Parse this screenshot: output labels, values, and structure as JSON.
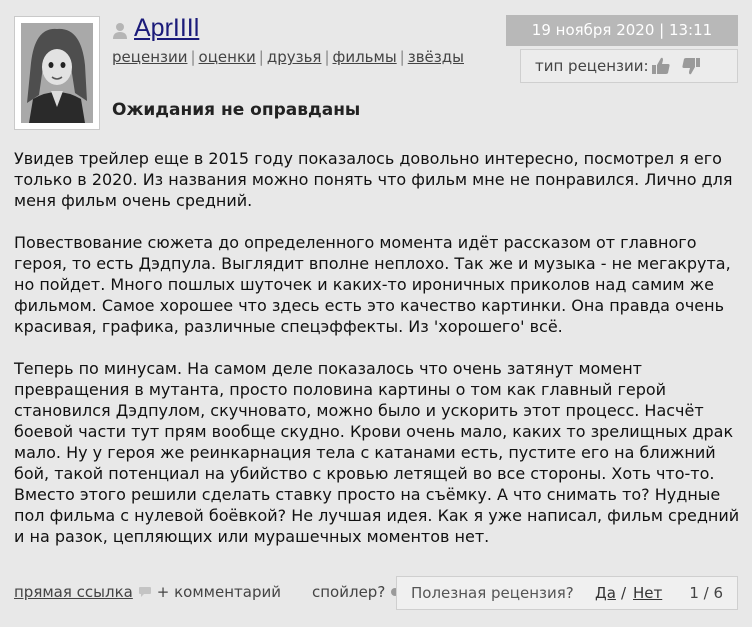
{
  "user": {
    "name": "AprIIIl",
    "tabs": [
      "рецензии",
      "оценки",
      "друзья",
      "фильмы",
      "звёзды"
    ]
  },
  "meta": {
    "date": "19 ноября 2020 | 13:11",
    "type_label": "тип рецензии:"
  },
  "review": {
    "title": "Ожидания не оправданы",
    "paragraphs": [
      "Увидев трейлер еще в 2015 году показалось довольно интересно, посмотрел я его только в 2020. Из названия можно понять что фильм мне не понравился. Лично для меня фильм очень средний.",
      "Повествование сюжета до определенного момента идёт рассказом от главного героя, то есть Дэдпула. Выглядит вполне неплохо. Так же и музыка - не мегакрута, но пойдет. Много пошлых шуточек и каких-то ироничных приколов над самим же фильмом. Самое хорошее что здесь есть это качество картинки. Она правда очень красивая, графика, различные спецэффекты. Из 'хорошего' всё.",
      "Теперь по минусам. На самом деле показалось что очень затянут момент превращения в мутанта, просто половина картины о том как главный герой становился Дэдпулом, скучновато, можно было и ускорить этот процесс. Насчёт боевой части тут прям вообще скудно. Крови очень мало, каких то зрелищных драк мало. Ну у героя же реинкарнация тела с катанами есть, пустите его на ближний бой, такой потенциал на убийство с кровью летящей во все стороны. Хоть что-то. Вместо этого решили сделать ставку просто на съёмку. А что снимать то? Нудные пол фильма с нулевой боёвкой? Не лучшая идея. Как я уже написал, фильм средний и на разок, цепляющих или мурашечных моментов нет."
    ]
  },
  "footer": {
    "direct_link": "прямая ссылка",
    "comment": "+ комментарий",
    "spoiler": "спойлер?",
    "useful_question": "Полезная рецензия?",
    "yes": "Да",
    "separator": "/",
    "no": "Нет",
    "count": "1 / 6"
  }
}
